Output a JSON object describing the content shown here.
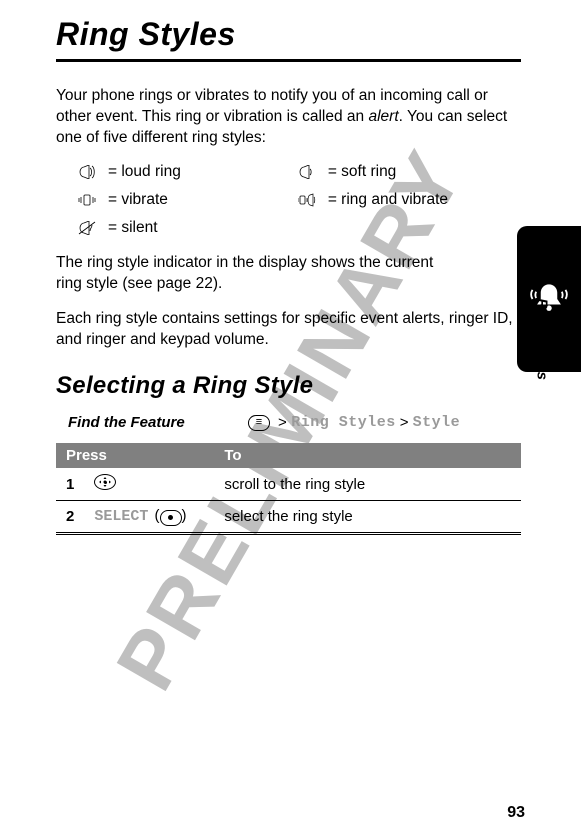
{
  "title": "Ring Styles",
  "watermark": "PRELIMINARY",
  "intro": "Your phone rings or vibrates to notify you of an incoming call or other event. This ring or vibration is called an ",
  "intro_italic": "alert",
  "intro_tail": ". You can select one of five different ring styles:",
  "rings": {
    "loud": "= loud ring",
    "soft": "= soft ring",
    "vibrate": "= vibrate",
    "ringvib": "= ring and vibrate",
    "silent": "= silent"
  },
  "para2": "The ring style indicator in the display shows the current ring style (see page 22).",
  "para3": "Each ring style contains settings for specific event alerts, ringer ID, and ringer and keypad volume.",
  "section_heading": "Selecting a Ring Style",
  "find_feature_label": "Find the Feature",
  "nav": {
    "gt1": ">",
    "ring_styles": "Ring Styles",
    "gt2": ">",
    "style": "Style"
  },
  "table": {
    "head_press": "Press",
    "head_to": "To",
    "row1": {
      "num": "1",
      "to": "scroll to the ring style"
    },
    "row2": {
      "num": "2",
      "select": "SELECT",
      "to": "select the ring style"
    }
  },
  "sidebar_label": "Ring Styles",
  "page_number": "93"
}
